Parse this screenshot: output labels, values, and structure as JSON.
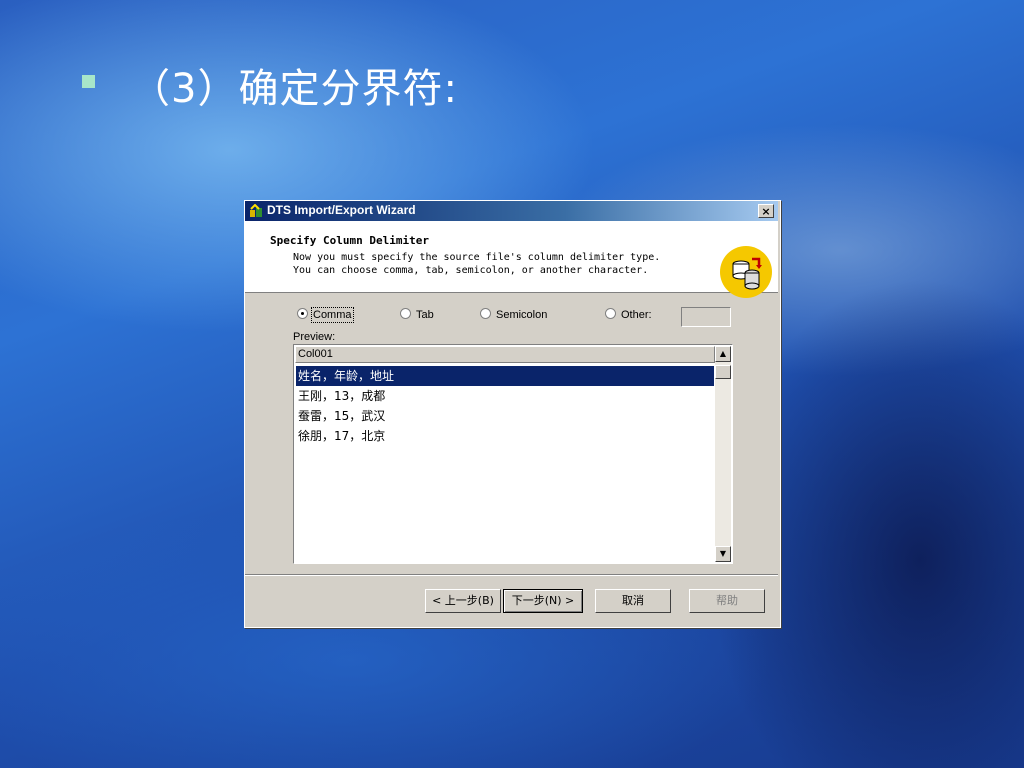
{
  "slide": {
    "title": "（3）确定分界符:"
  },
  "window": {
    "title": "DTS Import/Export Wizard",
    "close_label": "×"
  },
  "header": {
    "title": "Specify Column Delimiter",
    "description": "Now you must specify the source file's column delimiter type.\nYou can choose comma, tab, semicolon, or another character."
  },
  "delimiter": {
    "options": [
      {
        "label": "Comma",
        "selected": true
      },
      {
        "label": "Tab",
        "selected": false
      },
      {
        "label": "Semicolon",
        "selected": false
      },
      {
        "label": "Other:",
        "selected": false
      }
    ],
    "other_value": ""
  },
  "preview": {
    "label": "Preview:",
    "column_header": "Col001",
    "rows": [
      "姓名，年龄，地址",
      "王刚，13，成都",
      "蚕雷，15，武汉",
      "徐朋，17，北京"
    ],
    "selected_row": 0
  },
  "buttons": {
    "back": "< 上一步(B)",
    "next": "下一步(N) >",
    "cancel": "取消",
    "help": "帮助"
  },
  "colors": {
    "titlebar": "#0a246a",
    "selection": "#0a246a",
    "dialog_bg": "#d4d0c8"
  }
}
